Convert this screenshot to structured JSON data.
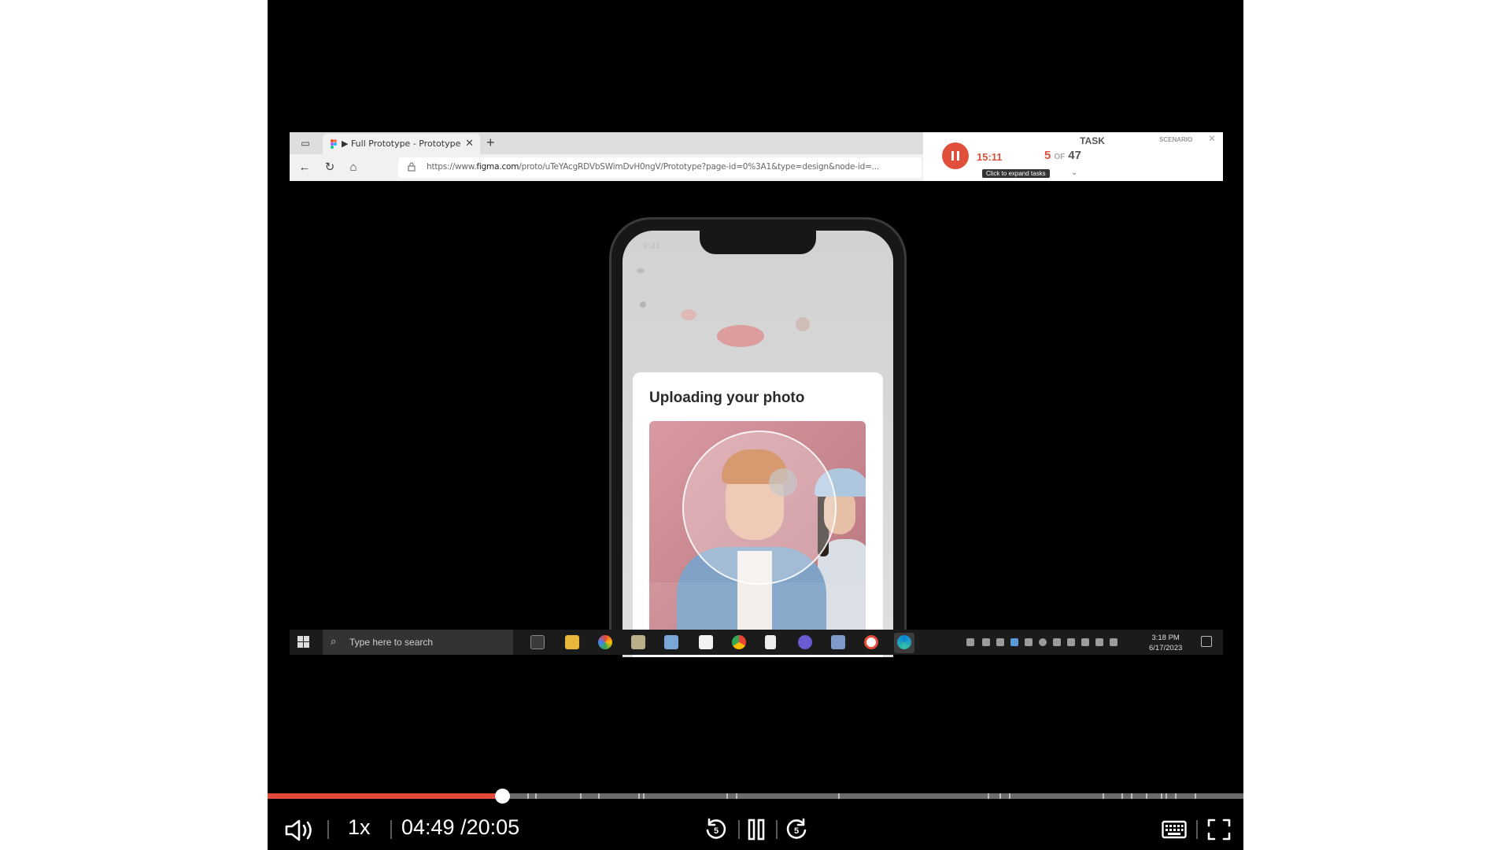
{
  "browser": {
    "tab_title": "▶ Full Prototype - Prototype",
    "url_prefix": "https://www.",
    "url_domain": "figma.com",
    "url_rest": "/proto/uTeYAcgRDVbSWimDvH0ngV/Prototype?page-id=0%3A1&type=design&node-id=..."
  },
  "task_panel": {
    "timer": "15:11",
    "label": "TASK",
    "current": "5",
    "of": "OF",
    "total": "47",
    "expand_hint": "Click to expand tasks",
    "scenario": "SCENARIO",
    "accent": "#e0503a"
  },
  "phone": {
    "status_time": "9:41",
    "upload_title": "Uploading your photo"
  },
  "taskbar": {
    "search_placeholder": "Type here to search",
    "time": "3:18 PM",
    "date": "6/17/2023"
  },
  "player": {
    "speed": "1x",
    "current_time": "04:49",
    "total_time": "/20:05",
    "progress_fraction": 0.24,
    "chapter_marks": [
      0.266,
      0.274,
      0.32,
      0.339,
      0.38,
      0.385,
      0.47,
      0.48,
      0.585,
      0.738,
      0.75,
      0.76,
      0.856,
      0.875,
      0.885,
      0.9,
      0.915,
      0.92,
      0.93,
      0.95
    ],
    "progress_color": "#e0483a"
  }
}
